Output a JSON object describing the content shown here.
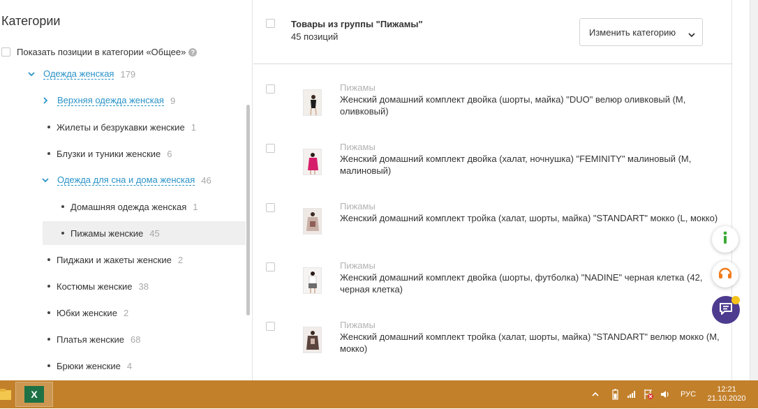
{
  "sidebar": {
    "title": "Категории",
    "show_general_label": "Показать позиции в категории «Общее»",
    "help_glyph": "?",
    "tree": [
      {
        "label": "Одежда женская",
        "count": "179",
        "type": "link",
        "chevron": "down"
      },
      {
        "label": "Верхняя одежда женская",
        "count": "9",
        "type": "link",
        "chevron": "right"
      },
      {
        "label": "Жилеты и безрукавки женские",
        "count": "1",
        "type": "dot"
      },
      {
        "label": "Блузки и туники женские",
        "count": "6",
        "type": "dot"
      },
      {
        "label": "Одежда для сна и дома женская",
        "count": "46",
        "type": "link",
        "chevron": "down"
      },
      {
        "label": "Домашняя одежда женская",
        "count": "1",
        "type": "dot"
      },
      {
        "label": "Пижамы женские",
        "count": "45",
        "type": "dot",
        "active": true
      },
      {
        "label": "Пиджаки и жакеты женские",
        "count": "2",
        "type": "dot"
      },
      {
        "label": "Костюмы женские",
        "count": "38",
        "type": "dot"
      },
      {
        "label": "Юбки женские",
        "count": "2",
        "type": "dot"
      },
      {
        "label": "Платья женские",
        "count": "68",
        "type": "dot"
      },
      {
        "label": "Брюки женские",
        "count": "4",
        "type": "dot"
      }
    ]
  },
  "header": {
    "group_title": "Товары из группы \"Пижамы\"",
    "group_count": "45 позиций",
    "change_category_label": "Изменить категорию"
  },
  "items": [
    {
      "category": "Пижамы",
      "name": "Женский домашний комплект двойка (шорты, майка) \"DUO\" велюр оливковый (M, оливковый)"
    },
    {
      "category": "Пижамы",
      "name": "Женский домашний комплект двойка (халат, ночнушка) \"FEMINITY\" малиновый (M, малиновый)"
    },
    {
      "category": "Пижамы",
      "name": "Женский домашний комплект тройка (халат, шорты, майка) \"STANDART\" мокко (L, мокко)"
    },
    {
      "category": "Пижамы",
      "name": "Женский домашний комплект двойка (шорты, футболка) \"NADINE\" черная клетка (42, черная клетка)"
    },
    {
      "category": "Пижамы",
      "name": "Женский домашний комплект тройка (халат, шорты, майка) \"STANDART\" велюр мокко (M, мокко)"
    }
  ],
  "widgets": {
    "info_icon": "info-icon",
    "support_icon": "headset-icon",
    "chat_icon": "chat-icon"
  },
  "taskbar": {
    "lang": "РУС",
    "time": "12:21",
    "date": "21.10.2020",
    "excel_letter": "X"
  },
  "colors": {
    "link": "#2a93c7",
    "count": "#a8a8a8",
    "taskbar": "#c2802b",
    "chat": "#4d3b8f",
    "info_green": "#3aaa35",
    "support_orange": "#f07b1b"
  }
}
